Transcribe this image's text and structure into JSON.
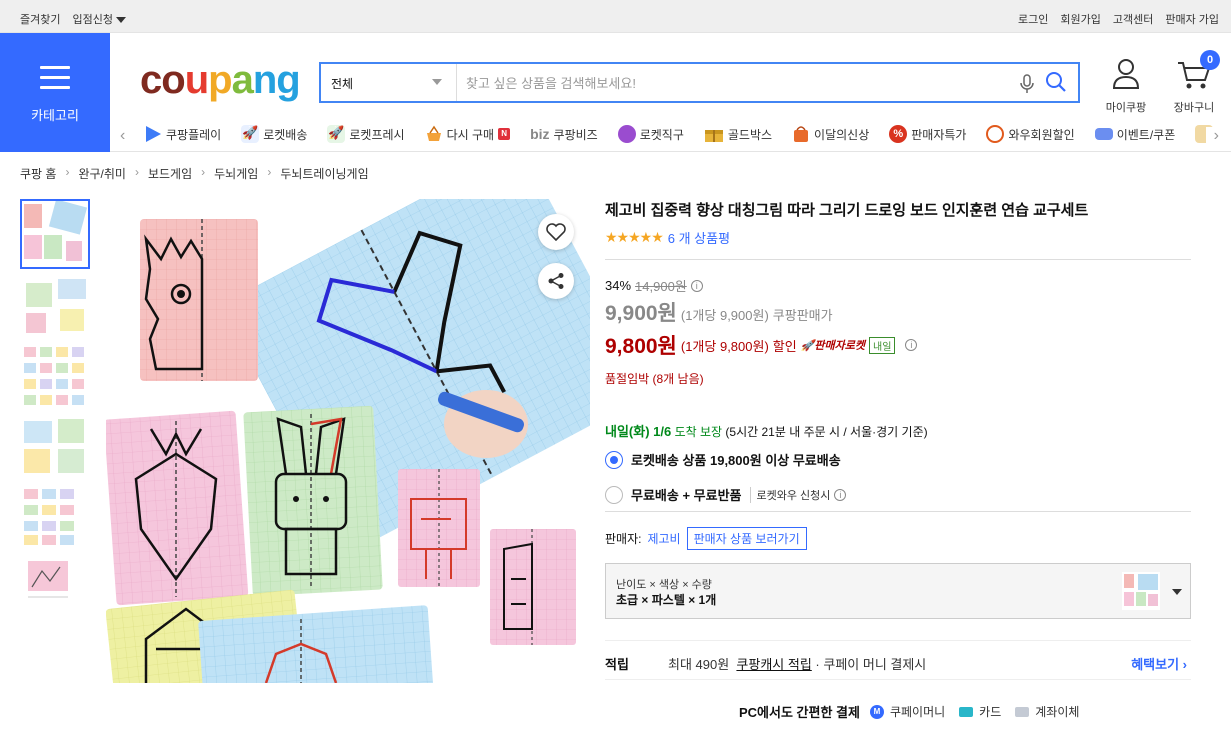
{
  "topbar": {
    "left": [
      {
        "label": "즐겨찾기"
      },
      {
        "label": "입점신청"
      }
    ],
    "right": [
      {
        "label": "로그인"
      },
      {
        "label": "회원가입"
      },
      {
        "label": "고객센터"
      },
      {
        "label": "판매자 가입"
      }
    ]
  },
  "header": {
    "category_label": "카테고리",
    "logo_text": "coupang",
    "search": {
      "scope": "전체",
      "placeholder": "찾고 싶은 상품을 검색해보세요!"
    },
    "my_label": "마이쿠팡",
    "cart_label": "장바구니",
    "cart_count": "0"
  },
  "shortcuts": [
    {
      "label": "쿠팡플레이"
    },
    {
      "label": "로켓배송"
    },
    {
      "label": "로켓프레시"
    },
    {
      "label": "다시 구매"
    },
    {
      "label": "쿠팡비즈"
    },
    {
      "label": "로켓직구"
    },
    {
      "label": "골드박스"
    },
    {
      "label": "이달의신상"
    },
    {
      "label": "판매자특가"
    },
    {
      "label": "와우회원할인"
    },
    {
      "label": "이벤트/쿠폰"
    }
  ],
  "biz_prefix": "biz",
  "breadcrumb": [
    "쿠팡 홈",
    "완구/취미",
    "보드게임",
    "두뇌게임",
    "두뇌트레이닝게임"
  ],
  "product": {
    "title": "제고비 집중력 향상 대칭그림 따라 그리기 드로잉 보드 인지훈련 연습 교구세트",
    "stars": "★★★★★",
    "review_count": "6 개 상품평",
    "discount_rate": "34%",
    "original_price": "14,900원",
    "price": "9,900원",
    "price_unit": "(1개당 9,900원)",
    "price_label": "쿠팡판매가",
    "sale_price": "9,800원",
    "sale_unit": "(1개당 9,800원)",
    "sale_label": "할인",
    "rocket_badge": "🚀판매자로켓",
    "tomorrow_badge": "내일",
    "stock_note": "품절임박 (8개 남음)",
    "delivery_date": "내일(화) 1/6",
    "delivery_guarantee": "도착 보장",
    "delivery_cond": "(5시간 21분 내 주문 시 / 서울·경기 기준)",
    "ship_opt1": "로켓배송 상품 19,800원 이상 무료배송",
    "ship_opt2": "무료배송 + 무료반품",
    "ship_opt2_sub": "로켓와우 신청시",
    "seller_label": "판매자:",
    "seller_name": "제고비",
    "seller_btn": "판매자 상품 보러가기",
    "option_label": "난이도 × 색상 × 수량",
    "option_value": "초급 × 파스텔 × 1개",
    "reward_title": "적립",
    "reward_text": "최대 490원",
    "reward_link": "쿠팡캐시 적립",
    "reward_tail": "· 쿠페이 머니 결제시",
    "reward_more": "혜택보기 ›",
    "pay_title": "PC에서도 간편한 결제",
    "pay_money": "쿠페이머니",
    "pay_card": "카드",
    "pay_bank": "계좌이체"
  },
  "colors": {
    "accent": "#346aff",
    "sale": "#ae0000",
    "delivery": "#00891a"
  }
}
